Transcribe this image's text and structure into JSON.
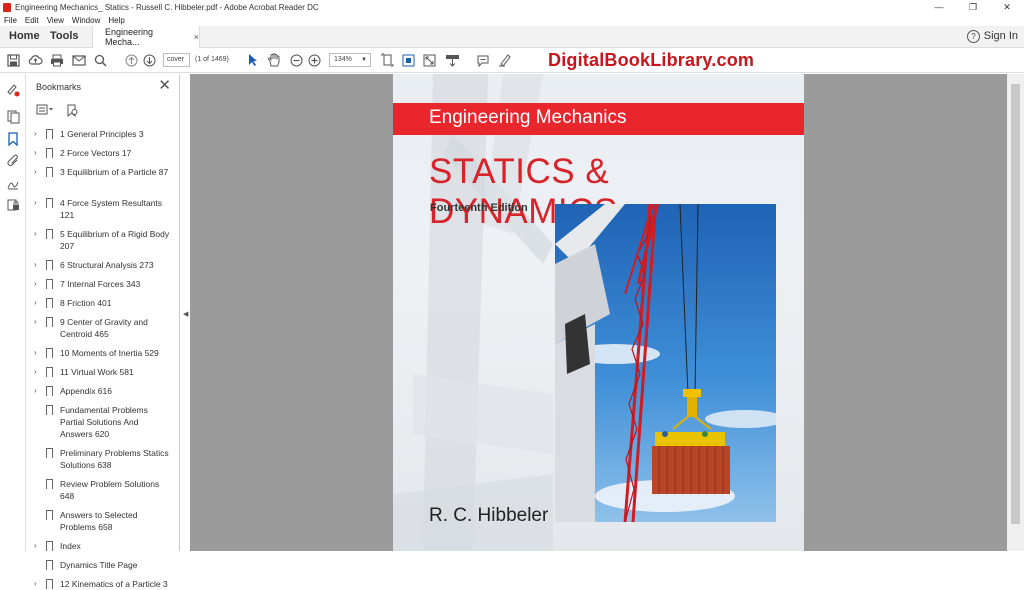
{
  "window": {
    "title": "Engineering Mechanics_ Statics - Russell C. Hibbeler.pdf - Adobe Acrobat Reader DC",
    "minimize": "—",
    "restore": "❐",
    "close": "✕"
  },
  "menu": [
    "File",
    "Edit",
    "View",
    "Window",
    "Help"
  ],
  "nav": {
    "home": "Home",
    "tools": "Tools"
  },
  "doc_tab": {
    "label": "Engineering Mecha...",
    "close": "×"
  },
  "account": {
    "help": "?",
    "signin": "Sign In"
  },
  "toolbar": {
    "page_input": "cover",
    "page_count": "(1 of 1469)",
    "zoom": "134%"
  },
  "watermark": "DigitalBookLibrary.com",
  "bookmarks": {
    "title": "Bookmarks",
    "items": [
      {
        "label": "1 General Principles 3",
        "expandable": true
      },
      {
        "label": "2 Force Vectors 17",
        "expandable": true
      },
      {
        "label": "3 Equilibrium of a Particle 87",
        "expandable": true
      },
      {
        "label": "4 Force System Resultants 121",
        "expandable": true
      },
      {
        "label": "5 Equilibrium of a Rigid Body 207",
        "expandable": true
      },
      {
        "label": "6 Structural Analysis 273",
        "expandable": true
      },
      {
        "label": "7 Internal Forces 343",
        "expandable": true
      },
      {
        "label": "8 Friction 401",
        "expandable": true
      },
      {
        "label": "9 Center of Gravity and Centroid 465",
        "expandable": true
      },
      {
        "label": "10 Moments of Inertia 529",
        "expandable": true
      },
      {
        "label": "11 Virtual Work 581",
        "expandable": true
      },
      {
        "label": "Appendix 616",
        "expandable": true
      },
      {
        "label": "Fundamental Problems Partial Solutions And Answers 620",
        "expandable": false
      },
      {
        "label": "Preliminary Problems Statics Solutions 638",
        "expandable": false
      },
      {
        "label": "Review Problem Solutions 648",
        "expandable": false
      },
      {
        "label": "Answers to Selected Problems 658",
        "expandable": false
      },
      {
        "label": "Index",
        "expandable": true
      },
      {
        "label": "Dynamics Title Page",
        "expandable": false
      },
      {
        "label": "12 Kinematics of a Particle 3",
        "expandable": true
      }
    ]
  },
  "cover": {
    "series": "Engineering Mechanics",
    "title": "STATICS & DYNAMICS",
    "edition": "Fourteenth Edition",
    "author": "R. C. Hibbeler"
  }
}
